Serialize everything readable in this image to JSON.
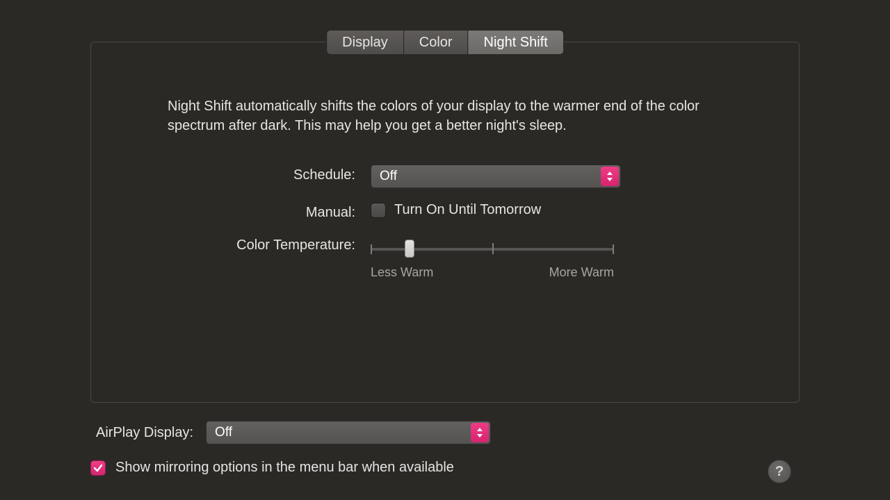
{
  "tabs": {
    "display": "Display",
    "color": "Color",
    "night_shift": "Night Shift"
  },
  "panel": {
    "description": "Night Shift automatically shifts the colors of your display to the warmer end of the color spectrum after dark. This may help you get a better night's sleep.",
    "schedule_label": "Schedule:",
    "schedule_value": "Off",
    "manual_label": "Manual:",
    "manual_checkbox_label": "Turn On Until Tomorrow",
    "manual_checked": false,
    "color_temp_label": "Color Temperature:",
    "slider": {
      "min_label": "Less Warm",
      "max_label": "More Warm",
      "value_percent": 16
    }
  },
  "footer": {
    "airplay_label": "AirPlay Display:",
    "airplay_value": "Off",
    "mirroring_checked": true,
    "mirroring_label": "Show mirroring options in the menu bar when available",
    "help_label": "?"
  },
  "colors": {
    "accent": "#e73185"
  }
}
